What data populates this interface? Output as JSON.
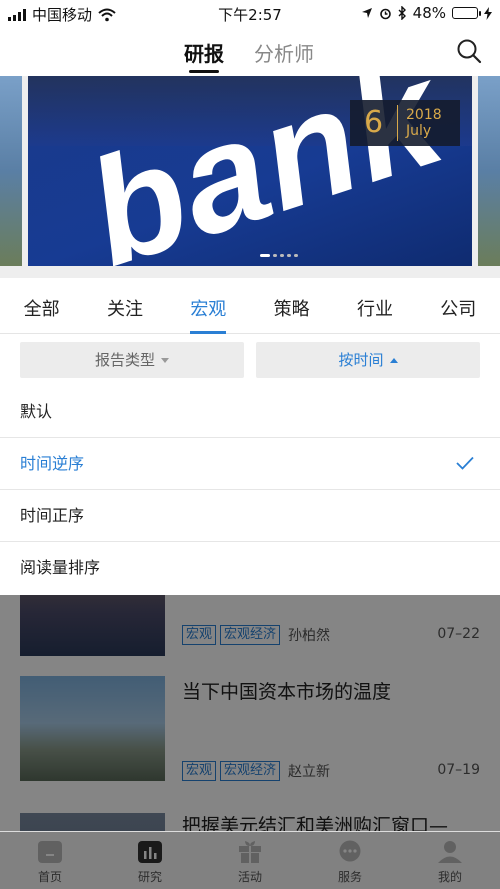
{
  "status_bar": {
    "carrier": "中国移动",
    "time": "下午2:57",
    "battery": "48%"
  },
  "header": {
    "tab_active": "研报",
    "tab_inactive": "分析师",
    "search_icon": "search-icon"
  },
  "banner": {
    "word": "bank",
    "day": "6",
    "year": "2018",
    "month": "July",
    "slide_count": 5,
    "active_slide": 1
  },
  "categories": [
    "全部",
    "关注",
    "宏观",
    "策略",
    "行业",
    "公司"
  ],
  "active_category": "宏观",
  "filters": {
    "type_label": "报告类型",
    "sort_label": "按时间"
  },
  "sort_options": [
    {
      "label": "默认",
      "selected": false
    },
    {
      "label": "时间逆序",
      "selected": true
    },
    {
      "label": "时间正序",
      "selected": false
    },
    {
      "label": "阅读量排序",
      "selected": false
    }
  ],
  "articles": [
    {
      "title": "",
      "tags": [
        "宏观",
        "宏观经济"
      ],
      "author": "孙柏然",
      "date": "07–22"
    },
    {
      "title": "当下中国资本市场的温度",
      "tags": [
        "宏观",
        "宏观经济"
      ],
      "author": "赵立新",
      "date": "07–19"
    },
    {
      "title": "把握美元结汇和美洲购汇窗口—",
      "tags": [],
      "author": "",
      "date": ""
    }
  ],
  "tabbar": [
    {
      "label": "首页",
      "icon": "home-icon",
      "active": false
    },
    {
      "label": "研究",
      "icon": "chart-icon",
      "active": true
    },
    {
      "label": "活动",
      "icon": "gift-icon",
      "active": false
    },
    {
      "label": "服务",
      "icon": "chat-icon",
      "active": false
    },
    {
      "label": "我的",
      "icon": "user-icon",
      "active": false
    }
  ],
  "colors": {
    "accent": "#2a7fd4",
    "banner_blue": "#173b93",
    "date_gold": "#d8a94a"
  }
}
